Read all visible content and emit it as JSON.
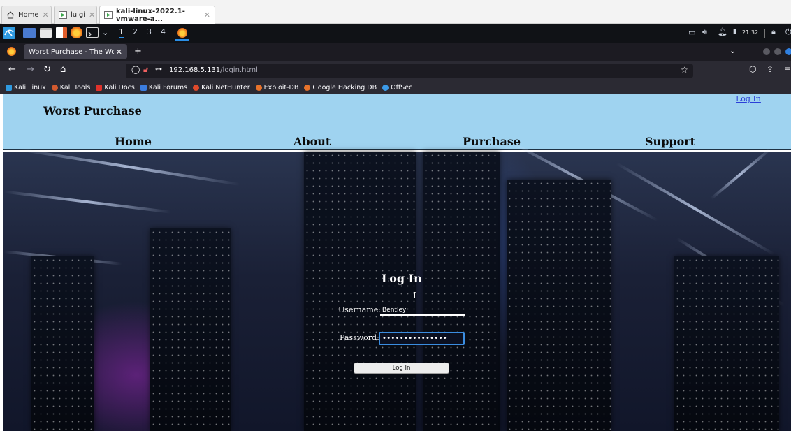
{
  "host_tabs": [
    {
      "label": "Home"
    },
    {
      "label": "luigi"
    },
    {
      "label": "kali-linux-2022.1-vmware-a..."
    }
  ],
  "panel": {
    "workspaces": [
      "1",
      "2",
      "3",
      "4"
    ],
    "clock": "21:32"
  },
  "browser": {
    "tab_title": "Worst Purchase - The Worst",
    "url_host": "192.168.5.131",
    "url_path": "/login.html",
    "bookmarks": [
      "Kali Linux",
      "Kali Tools",
      "Kali Docs",
      "Kali Forums",
      "Kali NetHunter",
      "Exploit-DB",
      "Google Hacking DB",
      "OffSec"
    ]
  },
  "site": {
    "brand": "Worst Purchase",
    "login_link": "Log In",
    "nav": [
      "Home",
      "About",
      "Purchase",
      "Support"
    ],
    "login": {
      "title": "Log In",
      "username_label": "Username:",
      "username_value": "Bentley",
      "password_label": "Password:",
      "password_value": "•••••••••••••••",
      "submit": "Log In"
    }
  },
  "colors": {
    "header_bg": "#9fd3f0",
    "link": "#2b3fd8",
    "focus_ring": "#3b8de0"
  }
}
